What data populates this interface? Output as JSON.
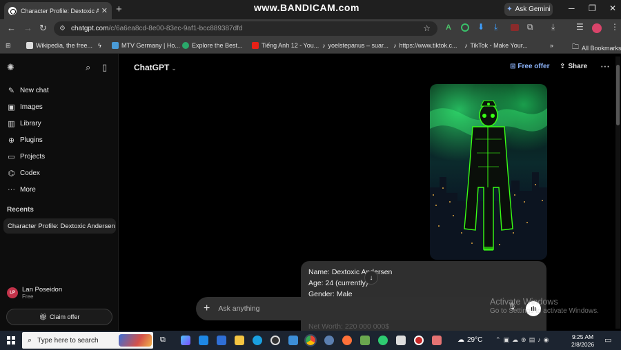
{
  "browser": {
    "tab_title": "Character Profile: Dextoxic And...",
    "tab_close": "✕",
    "new_tab": "+",
    "banner": "www.BANDICAM.com",
    "gemini_label": "Ask Gemini",
    "url_host": "chatgpt.com",
    "url_path": "/c/6a6ea8cd-8e00-83ec-9af1-bcc889387dfd",
    "bookmarks": [
      "Wikipedia, the free...",
      "MTV Germany | Ho...",
      "Explore the Best...",
      "Tiếng Anh 12 - You...",
      "yoelstepanus – suar...",
      "https://www.tiktok.c...",
      "TikTok - Make Your..."
    ],
    "all_bookmarks": "All Bookmarks",
    "overflow": "»"
  },
  "sidebar": {
    "items": [
      {
        "label": "New chat",
        "icon": "edit-icon"
      },
      {
        "label": "Images",
        "icon": "images-icon"
      },
      {
        "label": "Library",
        "icon": "library-icon"
      },
      {
        "label": "Plugins",
        "icon": "plugins-icon"
      },
      {
        "label": "Projects",
        "icon": "folder-icon"
      },
      {
        "label": "Codex",
        "icon": "codex-icon"
      },
      {
        "label": "More",
        "icon": "more-dots-icon"
      }
    ],
    "recents_label": "Recents",
    "recent_chats": [
      "Character Profile: Dextoxic Andersen"
    ],
    "user": {
      "initials": "LP",
      "name": "Lan Poseidon",
      "plan": "Free"
    },
    "claim_offer": "Claim offer"
  },
  "header": {
    "model": "ChatGPT",
    "free_offer": "Free offer",
    "share": "Share"
  },
  "message": {
    "lines": [
      "Name: Dextoxic Andersen",
      "Age: 24 (currently)",
      "Gender: Male"
    ],
    "faded_line": "Net Worth: 220 000 000$"
  },
  "composer": {
    "placeholder": "Ask anything"
  },
  "watermark": {
    "title": "Activate Windows",
    "subtitle": "Go to Settings to activate Windows."
  },
  "taskbar": {
    "search_placeholder": "Type here to search",
    "temperature": "29°C",
    "time": "9:25 AM",
    "date": "2/8/2026"
  },
  "colors": {
    "accent_link": "#8fb7ff",
    "neon_green": "#39ff14",
    "aurora": "#1fbf5a"
  }
}
